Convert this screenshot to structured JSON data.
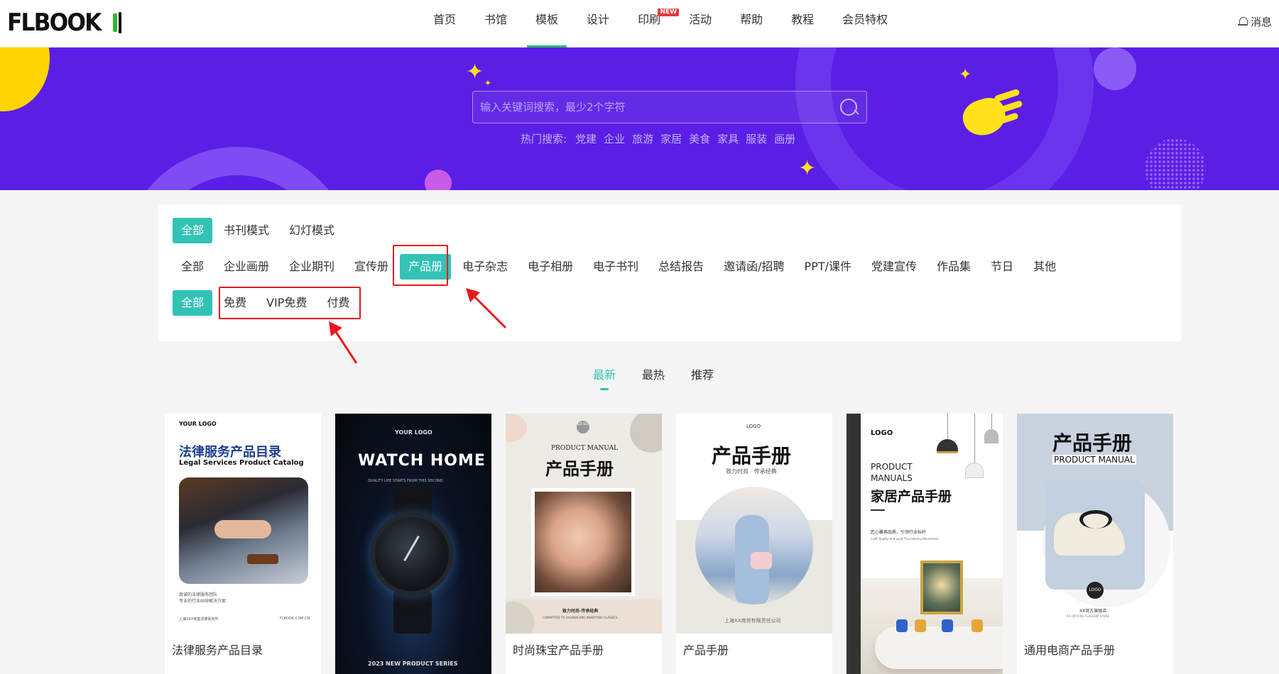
{
  "header": {
    "logo_text": "FLBOOK",
    "nav": [
      {
        "label": "首页"
      },
      {
        "label": "书馆"
      },
      {
        "label": "模板",
        "active": true
      },
      {
        "label": "设计"
      },
      {
        "label": "印刷",
        "badge": "NEW"
      },
      {
        "label": "活动"
      },
      {
        "label": "帮助"
      },
      {
        "label": "教程"
      },
      {
        "label": "会员特权"
      }
    ],
    "messages_label": "消息"
  },
  "banner": {
    "search_placeholder": "输入关键词搜索，最少2个字符",
    "hot_label": "热门搜索:",
    "hot_items": [
      "党建",
      "企业",
      "旅游",
      "家居",
      "美食",
      "家具",
      "服装",
      "画册"
    ]
  },
  "filters": {
    "mode": [
      "全部",
      "书刊模式",
      "幻灯模式"
    ],
    "mode_selected": "全部",
    "categories": [
      "全部",
      "企业画册",
      "企业期刊",
      "宣传册",
      "产品册",
      "电子杂志",
      "电子相册",
      "电子书刊",
      "总结报告",
      "邀请函/招聘",
      "PPT/课件",
      "党建宣传",
      "作品集",
      "节日",
      "其他"
    ],
    "category_selected": "产品册",
    "price": [
      "全部",
      "免费",
      "VIP免费",
      "付费"
    ],
    "price_selected": "全部"
  },
  "sort": {
    "tabs": [
      "最新",
      "最热",
      "推荐"
    ],
    "selected": "最新"
  },
  "cards": [
    {
      "title": "法律服务产品目录",
      "cover": {
        "logo": "YOUR LOGO",
        "heading": "法律服务产品目录",
        "subheading": "Legal Services Product Catalog",
        "line1": "真诚的法律服务团队",
        "line2": "专业的行业纠纷解决方案",
        "footer_left": "上海XXX家庭法律事务所",
        "footer_right": "FLBOOK.COM.CN"
      }
    },
    {
      "title": "",
      "cover": {
        "logo": "YOUR LOGO",
        "heading": "WATCH HOME",
        "subheading": "QUALITY LIFE STARTS FROM THIS SECOND",
        "footer": "2023 NEW PRODUCT SERIES"
      }
    },
    {
      "title": "时尚珠宝产品手册",
      "cover": {
        "logo": "LO GO",
        "kicker": "PRODUCT MANUAL",
        "heading": "产品手册",
        "line1": "致力时尚·传承经典",
        "line2": "COMMITTED TO FASHION AND INHERITING CLASSICS"
      }
    },
    {
      "title": "产品手册",
      "cover": {
        "logo": "LOGO",
        "heading": "产品手册",
        "subheading": "致力时尚 · 传承经典",
        "footer": "上海XX商贸有限责任公司"
      }
    },
    {
      "title": "",
      "cover": {
        "logo": "LOGO",
        "kicker1": "PRODUCT",
        "kicker2": "MANUALS",
        "heading": "家居产品手册",
        "line1": "匠心雕琢品质，引领行业标杆",
        "line2": "Craft Quality And Lead The Industry Benchmark"
      }
    },
    {
      "title": "通用电商产品手册",
      "cover": {
        "heading": "产品手册",
        "subheading": "PRODUCT MANUAL",
        "logo": "LOGO",
        "footer1": "XX官方旗舰店",
        "footer2": "XX OFFICIAL FLAGSHIP STORE"
      }
    }
  ],
  "colors": {
    "banner": "#5b1ee6",
    "accent": "#33c2b6",
    "nav_active": "#2bb673",
    "annotation": "#e8191d"
  }
}
